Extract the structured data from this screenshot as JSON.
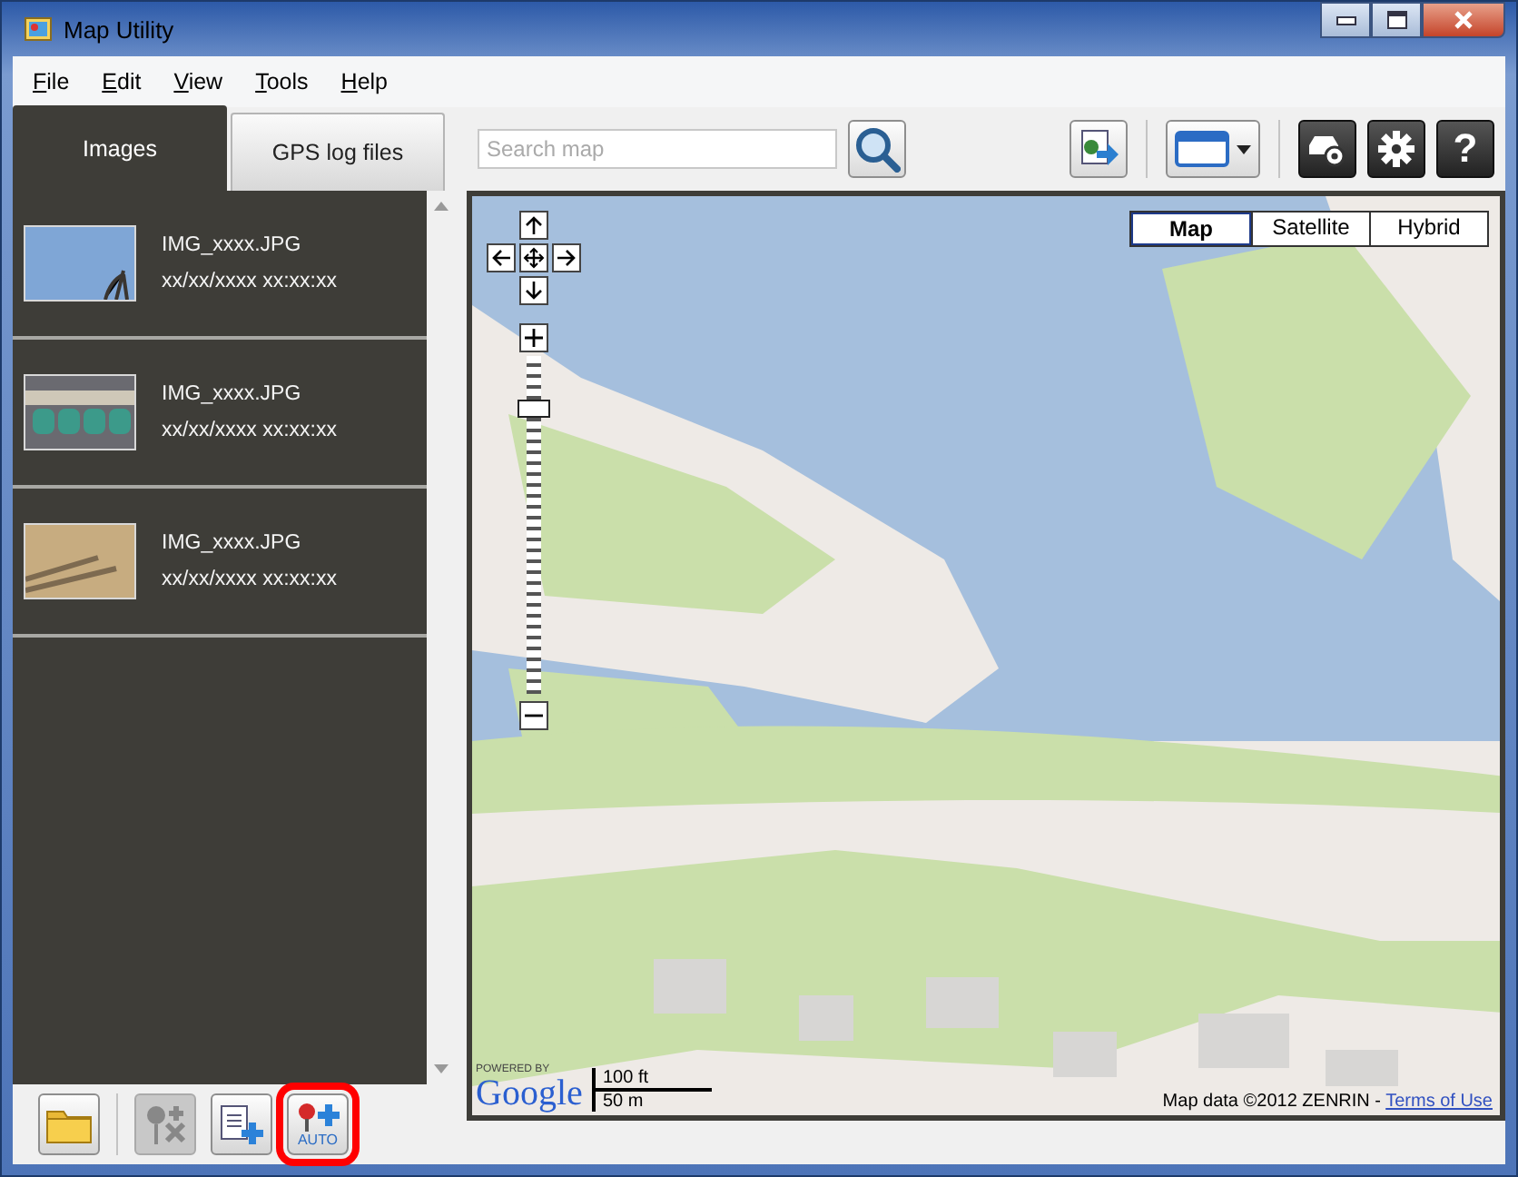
{
  "window": {
    "title": "Map Utility"
  },
  "menu": [
    {
      "label": "File"
    },
    {
      "label": "Edit"
    },
    {
      "label": "View"
    },
    {
      "label": "Tools"
    },
    {
      "label": "Help"
    }
  ],
  "tabs": [
    {
      "label": "Images",
      "selected": true
    },
    {
      "label": "GPS log files",
      "selected": false
    }
  ],
  "search": {
    "placeholder": "Search map"
  },
  "help_button": {
    "label": "?"
  },
  "images": [
    {
      "name": "IMG_xxxx.JPG",
      "date": "xx/xx/xxxx xx:xx:xx"
    },
    {
      "name": "IMG_xxxx.JPG",
      "date": "xx/xx/xxxx xx:xx:xx"
    },
    {
      "name": "IMG_xxxx.JPG",
      "date": "xx/xx/xxxx xx:xx:xx"
    }
  ],
  "map": {
    "types": [
      {
        "label": "Map",
        "selected": true
      },
      {
        "label": "Satellite",
        "selected": false
      },
      {
        "label": "Hybrid",
        "selected": false
      }
    ],
    "zoom": {
      "level": 0.86
    },
    "powered_by": "POWERED BY",
    "logo": "Google",
    "scale": {
      "imperial": "100 ft",
      "metric": "50 m"
    },
    "attribution": "Map data ©2012 ZENRIN - ",
    "terms_link": "Terms of Use"
  },
  "bottom_tools": [
    {
      "kind": "folder",
      "disabled": false,
      "highlighted": false
    },
    {
      "kind": "remove-pin",
      "disabled": true,
      "highlighted": false
    },
    {
      "kind": "add-file",
      "disabled": false,
      "highlighted": false
    },
    {
      "kind": "auto",
      "label": "AUTO",
      "disabled": false,
      "highlighted": true
    }
  ]
}
